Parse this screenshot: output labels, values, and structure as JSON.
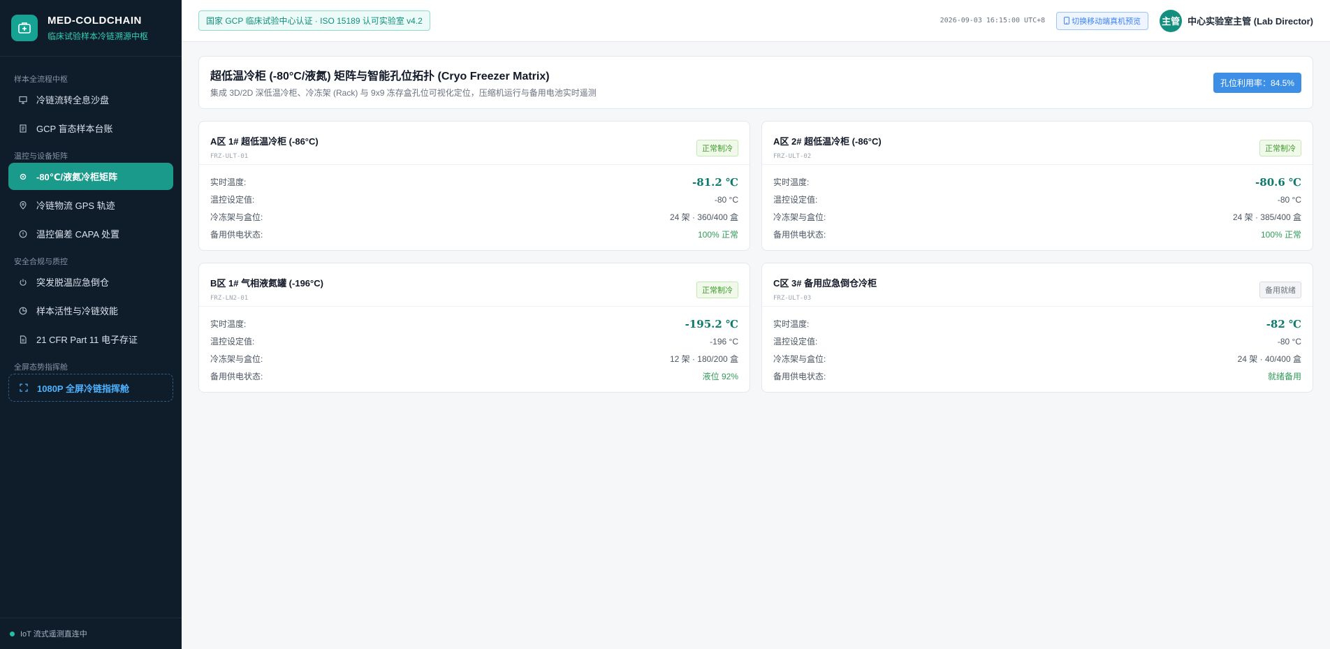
{
  "brand": {
    "name": "MED-COLDCHAIN",
    "subtitle": "临床试验样本冷链溯源中枢"
  },
  "sidebar": {
    "groups": [
      {
        "label": "样本全流程中枢",
        "items": [
          {
            "label": "冷链流转全息沙盘",
            "icon": "monitor-icon"
          },
          {
            "label": "GCP 盲态样本台账",
            "icon": "document-icon"
          }
        ]
      },
      {
        "label": "温控与设备矩阵",
        "items": [
          {
            "label": "-80℃/液氮冷柜矩阵",
            "icon": "settings-icon",
            "active": true
          },
          {
            "label": "冷链物流 GPS 轨迹",
            "icon": "location-pin-icon"
          },
          {
            "label": "温控偏差 CAPA 处置",
            "icon": "info-icon"
          }
        ]
      },
      {
        "label": "安全合规与质控",
        "items": [
          {
            "label": "突发脱温应急倒仓",
            "icon": "power-icon"
          },
          {
            "label": "样本活性与冷链效能",
            "icon": "pie-chart-icon"
          },
          {
            "label": "21 CFR Part 11 电子存证",
            "icon": "file-icon"
          }
        ]
      },
      {
        "label": "全屏态势指挥舱",
        "items": [
          {
            "label": "1080P 全屏冷链指挥舱",
            "icon": "fullscreen-icon"
          }
        ]
      }
    ],
    "footer": "IoT 流式遥测直连中"
  },
  "header": {
    "cert": "国家 GCP 临床试验中心认证 · ISO 15189 认可实验室 v4.2",
    "datetime": "2026-09-03 16:15:00 UTC+8",
    "mobile_button": "切换移动端真机预览",
    "avatar_text": "主管",
    "user": "中心实验室主管 (Lab Director)"
  },
  "page": {
    "title": "超低温冷柜 (-80°C/液氮) 矩阵与智能孔位拓扑 (Cryo Freezer Matrix)",
    "subtitle": "集成 3D/2D 深低温冷柜、冷冻架 (Rack) 与 9x9 冻存盒孔位可视化定位，压缩机运行与备用电池实时遥测",
    "utilization": "孔位利用率：84.5%"
  },
  "labels": {
    "temp": "实时温度:",
    "setpoint": "温控设定值:",
    "racks": "冷冻架与盒位:",
    "backup": "备用供电状态:"
  },
  "freezers": [
    {
      "name": "A区 1# 超低温冷柜 (-86°C)",
      "id": "FRZ-ULT-01",
      "status": "正常制冷",
      "temp": "-81.2 ℃",
      "setpoint": "-80 °C",
      "racks": "24 架 · 360/400 盒",
      "backup": "100% 正常"
    },
    {
      "name": "A区 2# 超低温冷柜 (-86°C)",
      "id": "FRZ-ULT-02",
      "status": "正常制冷",
      "temp": "-80.6 ℃",
      "setpoint": "-80 °C",
      "racks": "24 架 · 385/400 盒",
      "backup": "100% 正常"
    },
    {
      "name": "B区 1# 气相液氮罐 (-196°C)",
      "id": "FRZ-LN2-01",
      "status": "正常制冷",
      "temp": "-195.2 ℃",
      "setpoint": "-196 °C",
      "racks": "12 架 · 180/200 盒",
      "backup": "液位 92%"
    },
    {
      "name": "C区 3# 备用应急倒仓冷柜",
      "id": "FRZ-ULT-03",
      "status": "备用就绪",
      "temp": "-82 ℃",
      "setpoint": "-80 °C",
      "racks": "24 架 · 40/400 盒",
      "backup": "就绪备用"
    }
  ],
  "colors": {
    "accent": "#1a9a8a",
    "sidebar_bg": "#0f1c2a",
    "badge_blue": "#3d8fe6",
    "status_green": "#3f9b2e"
  }
}
